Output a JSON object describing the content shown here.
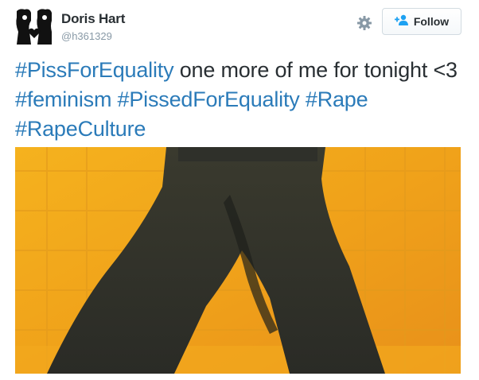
{
  "user": {
    "display_name": "Doris Hart",
    "handle": "@h361329"
  },
  "actions": {
    "settings_icon": "gear-icon",
    "follow_icon": "add-user-icon",
    "follow_label": "Follow"
  },
  "tweet": {
    "hashtag_1": "#PissForEquality",
    "text_1": " one more of me for tonight <3 ",
    "hashtag_2": "#feminism",
    "hashtag_3": "#PissedForEquality",
    "hashtag_4": "#Rape",
    "hashtag_5": "#RapeCulture"
  },
  "colors": {
    "link": "#2b7bb9",
    "text": "#292f33",
    "muted": "#8899a6",
    "photo_background": "#f0a21a"
  }
}
